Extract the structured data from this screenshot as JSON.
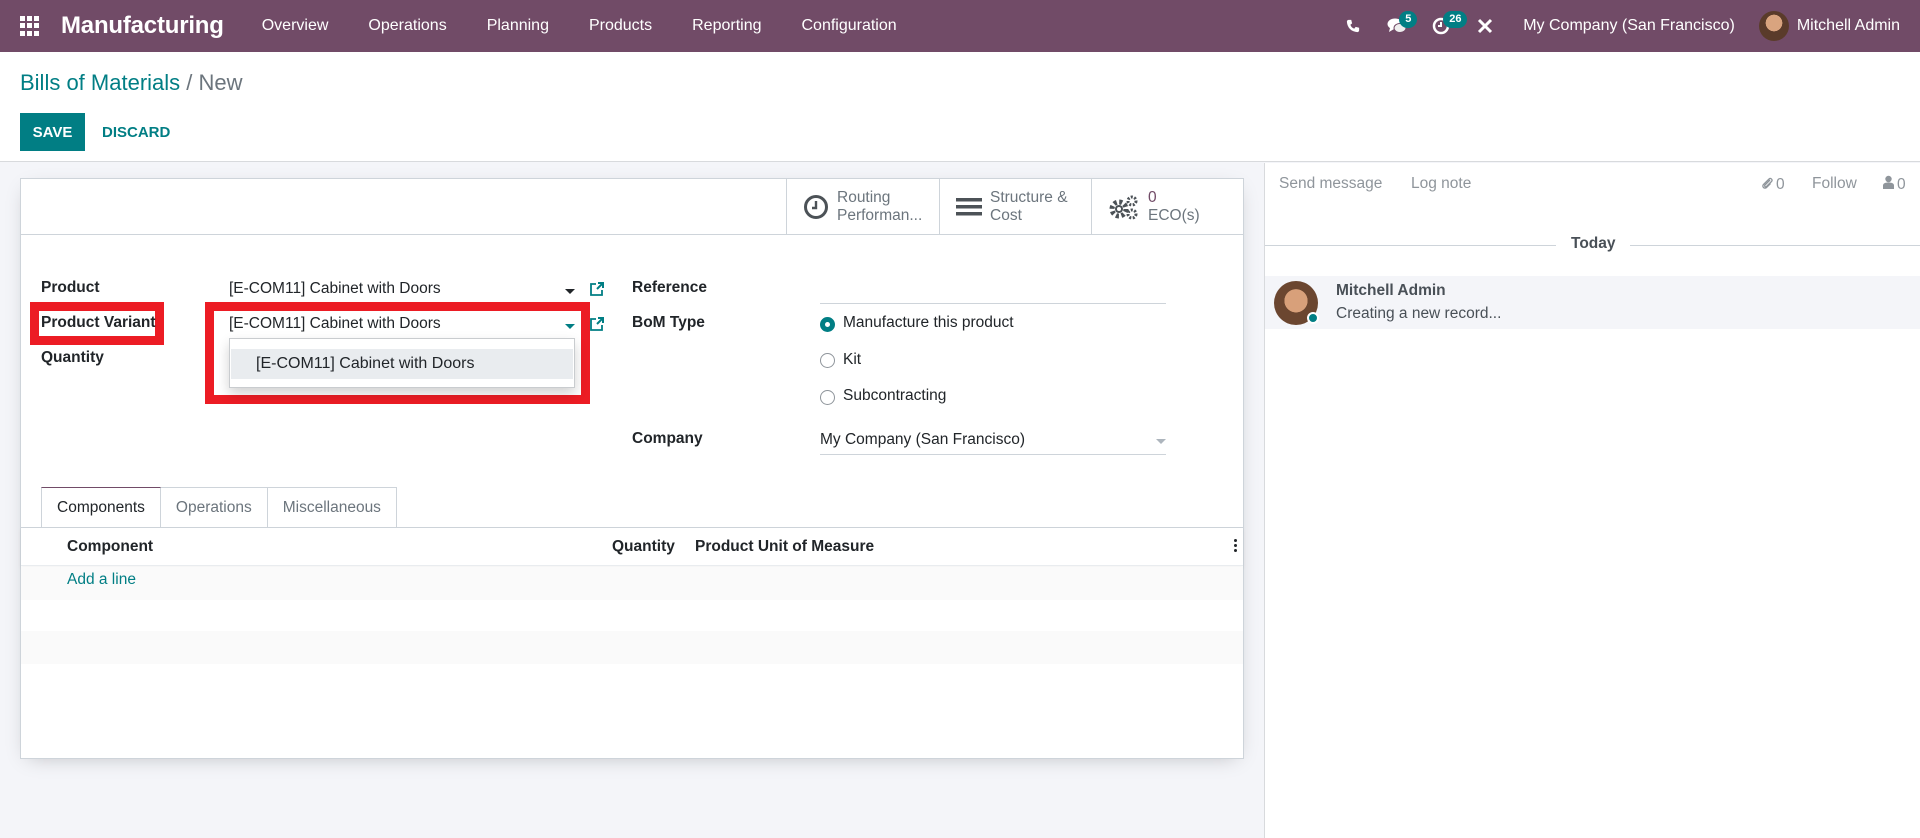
{
  "navbar": {
    "app_name": "Manufacturing",
    "menu": [
      "Overview",
      "Operations",
      "Planning",
      "Products",
      "Reporting",
      "Configuration"
    ],
    "messages_count": "5",
    "activities_count": "26",
    "company": "My Company (San Francisco)",
    "user": "Mitchell Admin"
  },
  "breadcrumb": {
    "parent": "Bills of Materials",
    "separator": "/",
    "current": "New"
  },
  "toolbar": {
    "save_label": "SAVE",
    "discard_label": "DISCARD"
  },
  "smart_buttons": [
    {
      "line1": "Routing",
      "line2": "Performan...",
      "icon": "clock-icon"
    },
    {
      "line1": "Structure &",
      "line2": "Cost",
      "icon": "bars-icon"
    },
    {
      "line1": "0",
      "line2": "ECO(s)",
      "icon": "cogs-icon"
    }
  ],
  "form": {
    "product_label": "Product",
    "product_value": "[E-COM11] Cabinet with Doors",
    "variant_label": "Product Variant",
    "variant_value": "[E-COM11] Cabinet with Doors",
    "variant_dropdown_options": [
      "[E-COM11] Cabinet with Doors"
    ],
    "quantity_label": "Quantity",
    "reference_label": "Reference",
    "reference_value": "",
    "bom_type_label": "BoM Type",
    "bom_type_options": [
      {
        "label": "Manufacture this product",
        "checked": true
      },
      {
        "label": "Kit",
        "checked": false
      },
      {
        "label": "Subcontracting",
        "checked": false
      }
    ],
    "company_label": "Company",
    "company_value": "My Company (San Francisco)"
  },
  "notebook": {
    "tabs": [
      "Components",
      "Operations",
      "Miscellaneous"
    ],
    "active_tab": "Components",
    "columns": [
      "Component",
      "Quantity",
      "Product Unit of Measure"
    ],
    "add_line_label": "Add a line"
  },
  "chatter": {
    "send_message": "Send message",
    "log_note": "Log note",
    "attachments_count": "0",
    "follow": "Follow",
    "followers_count": "0",
    "date_separator": "Today",
    "messages": [
      {
        "author": "Mitchell Admin",
        "body": "Creating a new record..."
      }
    ]
  },
  "colors": {
    "brand": "#714b67",
    "accent": "#017e84",
    "annotation": "#ec1c24"
  }
}
